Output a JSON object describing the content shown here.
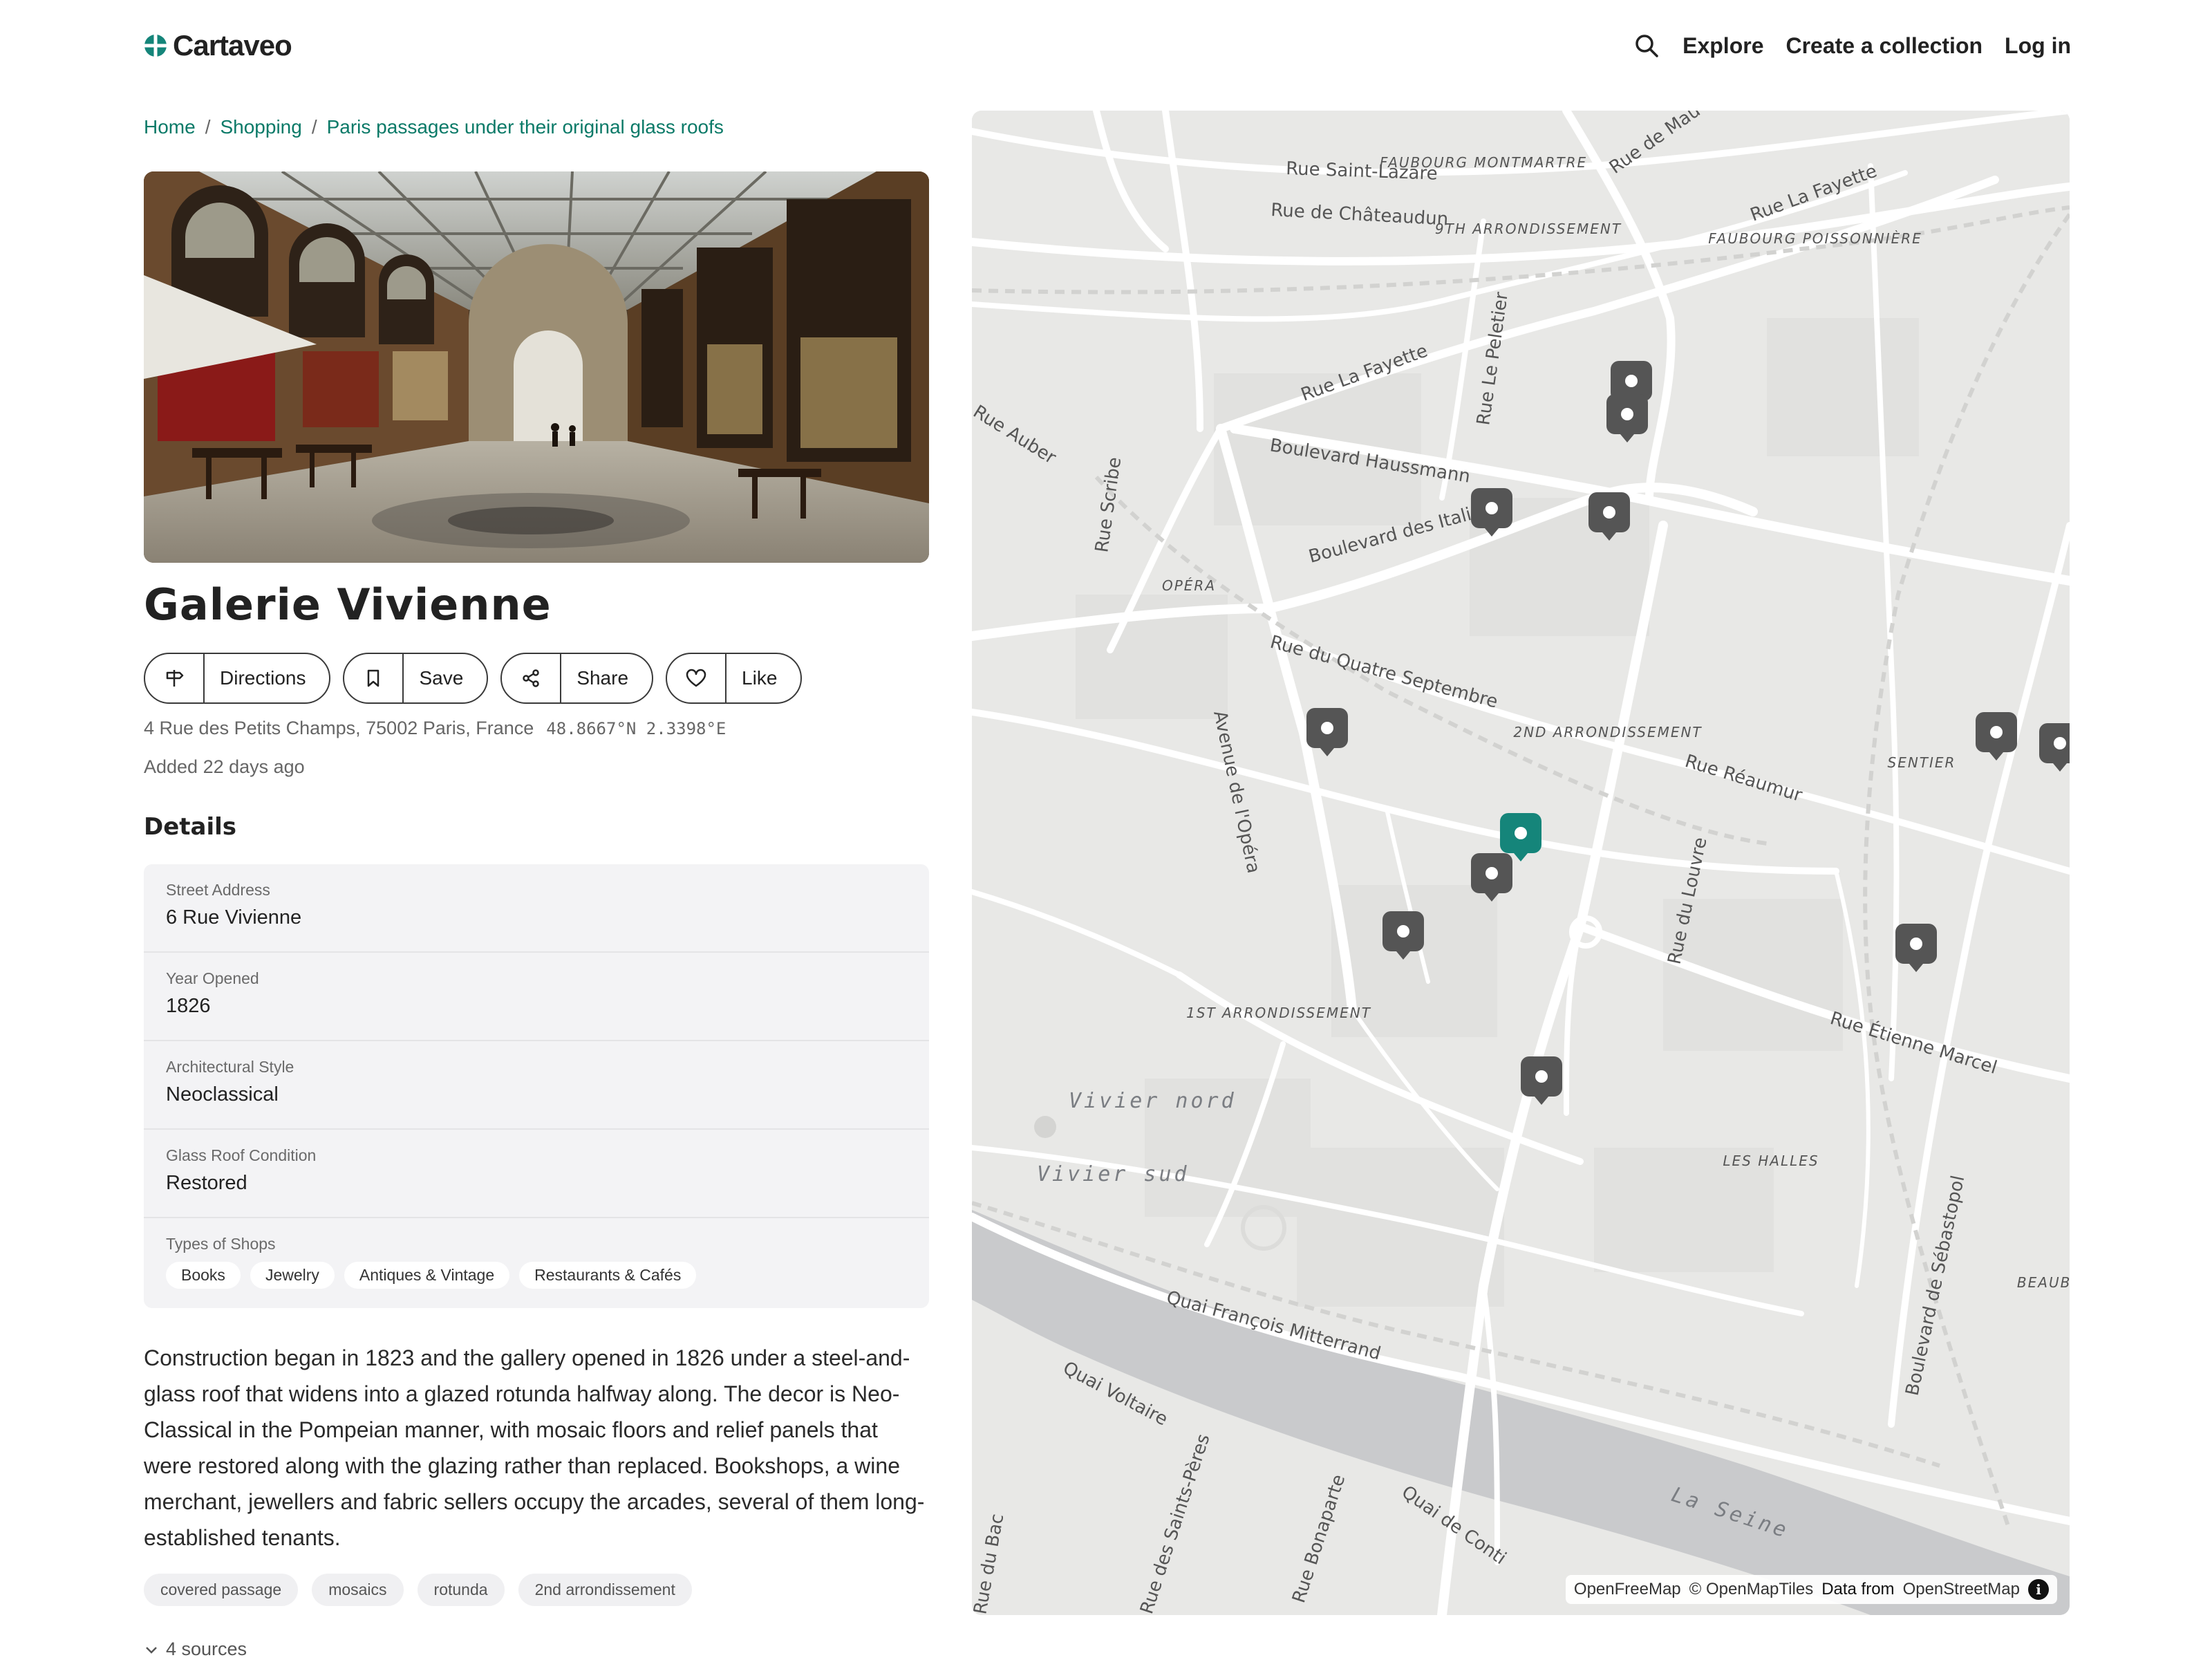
{
  "header": {
    "logo_text": "Cartaveo",
    "nav": [
      "Explore",
      "Create a collection",
      "Log in"
    ]
  },
  "breadcrumb": [
    "Home",
    "Shopping",
    "Paris passages under their original glass roofs"
  ],
  "place": {
    "title": "Galerie Vivienne",
    "address": "4 Rue des Petits Champs, 75002 Paris, France",
    "coords": "48.8667°N 2.3398°E",
    "added": "Added 22 days ago"
  },
  "actions": [
    {
      "label": "Directions",
      "icon": "signpost-icon"
    },
    {
      "label": "Save",
      "icon": "bookmark-icon"
    },
    {
      "label": "Share",
      "icon": "share-icon"
    },
    {
      "label": "Like",
      "icon": "heart-icon"
    }
  ],
  "details": {
    "heading": "Details",
    "rows": [
      {
        "label": "Street Address",
        "value": "6 Rue Vivienne"
      },
      {
        "label": "Year Opened",
        "value": "1826"
      },
      {
        "label": "Architectural Style",
        "value": "Neoclassical"
      },
      {
        "label": "Glass Roof Condition",
        "value": "Restored"
      }
    ],
    "shops_label": "Types of Shops",
    "shops": [
      "Books",
      "Jewelry",
      "Antiques & Vintage",
      "Restaurants & Cafés"
    ]
  },
  "description": "Construction began in 1823 and the gallery opened in 1826 under a steel-and-glass roof that widens into a glazed rotunda halfway along. The decor is Neo-Classical in the Pompeian manner, with mosaic floors and relief panels that were restored along with the glazing rather than replaced. Bookshops, a wine merchant, jewellers and fabric sellers occupy the arcades, several of them long-established tenants.",
  "tags": [
    "covered passage",
    "mosaics",
    "rotunda",
    "2nd arrondissement"
  ],
  "sources": "4 sources",
  "map": {
    "street_labels": [
      "Rue Saint-Lazare",
      "Rue de Châteaudun",
      "Rue La Fayette",
      "Rue La Fayette",
      "Boulevard Haussmann",
      "Boulevard des Italiens",
      "Rue du Quatre Septembre",
      "Rue Réaumur",
      "Rue Étienne Marcel",
      "Quai François Mitterrand",
      "Quai Voltaire",
      "Quai de Conti",
      "Rue Le Peletier",
      "Rue Scribe",
      "Avenue de l'Opéra",
      "Rue du Louvre",
      "Boulevard de Sébastopol",
      "Rue Bonaparte",
      "Rue des Saints-Pères",
      "Rue de Mau",
      "Rue Auber",
      "Rue du Bac"
    ],
    "area_labels": [
      "FAUBOURG MONTMARTRE",
      "9TH ARRONDISSEMENT",
      "FAUBOURG POISSONNIÈRE",
      "OPÉRA",
      "2ND ARRONDISSEMENT",
      "SENTIER",
      "1ST ARRONDISSEMENT",
      "LES HALLES",
      "BEAUBO"
    ],
    "water_labels": [
      "Vivier nord",
      "Vivier sud",
      "La Seine"
    ],
    "attribution": [
      "OpenFreeMap",
      "© OpenMapTiles",
      "Data from",
      "OpenStreetMap"
    ],
    "colors": {
      "active_pin": "#15857a",
      "pin": "#555555",
      "water": "#c9cacc",
      "road": "#ffffff",
      "land": "#e8e8e6"
    }
  }
}
